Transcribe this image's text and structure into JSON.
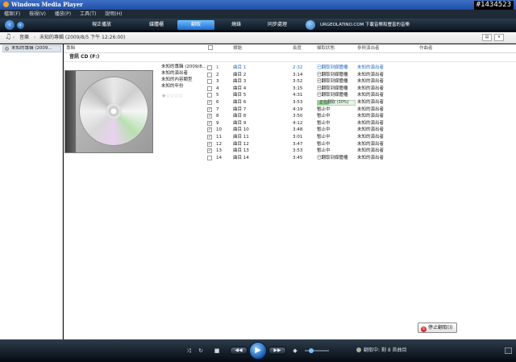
{
  "window": {
    "title": "Windows Media Player",
    "watermark": "#1434523"
  },
  "menu": [
    "檔案(F)",
    "檢視(V)",
    "播放(P)",
    "工具(T)",
    "說明(H)"
  ],
  "nav": {
    "tabs": [
      "現正播放",
      "媒體櫃",
      "翻取",
      "燒錄",
      "同步處理"
    ],
    "active_tab": "翻取",
    "promo": "URGEOLATINO.COM 下載音樂和豐富的音樂"
  },
  "breadcrumb": [
    "音樂",
    "未知的專輯 (2009/8/5 下午 12:26:00)"
  ],
  "left_pane": {
    "item": "未知的專輯 (2009..."
  },
  "columns": {
    "album": "專輯",
    "title": "標題",
    "length": "長度",
    "rip_status": "擷取狀態",
    "artist": "參與演出者",
    "composer": "作曲者"
  },
  "cd": {
    "drive_label": "音訊 CD (F:)",
    "album": "未知的專輯 (2009/8...",
    "artist": "未知的演出者",
    "genre": "未知的內容類型",
    "year": "未知的年份",
    "rating_stars": 5,
    "rating_value": 0
  },
  "tracks": [
    {
      "checked": false,
      "num": "1",
      "title": "曲目 1",
      "length": "2:32",
      "status": "已翻取到媒體櫃",
      "artist": "未知的演出者",
      "selected": true,
      "progress": null
    },
    {
      "checked": false,
      "num": "2",
      "title": "曲目 2",
      "length": "3:14",
      "status": "已翻取到媒體櫃",
      "artist": "未知的演出者",
      "selected": false,
      "progress": null
    },
    {
      "checked": false,
      "num": "3",
      "title": "曲目 3",
      "length": "3:52",
      "status": "已翻取到媒體櫃",
      "artist": "未知的演出者",
      "selected": false,
      "progress": null
    },
    {
      "checked": false,
      "num": "4",
      "title": "曲目 4",
      "length": "3:15",
      "status": "已翻取到媒體櫃",
      "artist": "未知的演出者",
      "selected": false,
      "progress": null
    },
    {
      "checked": false,
      "num": "5",
      "title": "曲目 5",
      "length": "4:31",
      "status": "已翻取到媒體櫃",
      "artist": "未知的演出者",
      "selected": false,
      "progress": null
    },
    {
      "checked": true,
      "num": "6",
      "title": "曲目 6",
      "length": "3:53",
      "status": "正在翻取 (30%)",
      "artist": "未知的演出者",
      "selected": false,
      "progress": 0.3
    },
    {
      "checked": true,
      "num": "7",
      "title": "曲目 7",
      "length": "4:19",
      "status": "暫止中",
      "artist": "未知的演出者",
      "selected": false,
      "progress": null
    },
    {
      "checked": true,
      "num": "8",
      "title": "曲目 8",
      "length": "3:50",
      "status": "暫止中",
      "artist": "未知的演出者",
      "selected": false,
      "progress": null
    },
    {
      "checked": true,
      "num": "9",
      "title": "曲目 9",
      "length": "4:12",
      "status": "暫止中",
      "artist": "未知的演出者",
      "selected": false,
      "progress": null
    },
    {
      "checked": true,
      "num": "10",
      "title": "曲目 10",
      "length": "3:48",
      "status": "暫止中",
      "artist": "未知的演出者",
      "selected": false,
      "progress": null
    },
    {
      "checked": true,
      "num": "11",
      "title": "曲目 11",
      "length": "3:01",
      "status": "暫止中",
      "artist": "未知的演出者",
      "selected": false,
      "progress": null
    },
    {
      "checked": true,
      "num": "12",
      "title": "曲目 12",
      "length": "3:47",
      "status": "暫止中",
      "artist": "未知的演出者",
      "selected": false,
      "progress": null
    },
    {
      "checked": true,
      "num": "13",
      "title": "曲目 13",
      "length": "3:53",
      "status": "暫止中",
      "artist": "未知的演出者",
      "selected": false,
      "progress": null
    },
    {
      "checked": false,
      "num": "14",
      "title": "曲目 14",
      "length": "3:45",
      "status": "已翻取到媒體櫃",
      "artist": "未知的演出者",
      "selected": false,
      "progress": null
    }
  ],
  "stop_button": "停止翻取(I)",
  "player": {
    "status": "翻取中: 剩 8 首曲目",
    "volume": 0.25
  },
  "colors": {
    "accent": "#1f6bd0",
    "selected_text": "#2a6ec4",
    "rip_progress": "#8fd08f",
    "title_bar": "#2a58b0"
  },
  "icons": [
    "back-icon",
    "forward-icon",
    "music-note-icon",
    "cd-disc-icon",
    "stop-icon",
    "shuffle-icon",
    "repeat-icon",
    "stop-playback-icon",
    "previous-icon",
    "play-icon",
    "next-icon",
    "mute-icon",
    "star-icon"
  ]
}
